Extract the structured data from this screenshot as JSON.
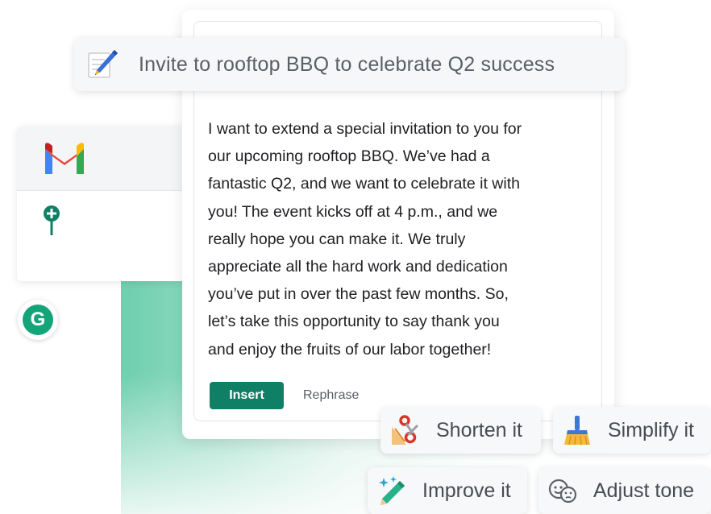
{
  "prompt": {
    "text": "Invite to rooftop BBQ to celebrate Q2 success",
    "icon": "pen-icon"
  },
  "message": {
    "lines": [
      "I want to extend a special invitation to you for",
      "our upcoming rooftop BBQ. We’ve had a",
      "fantastic Q2, and we want to celebrate it with",
      "you! The event kicks off at 4 p.m., and we",
      "really hope you can make it. We truly",
      "appreciate all the hard work and dedication",
      "you’ve put in over the past few months. So,",
      "let’s take this opportunity to say thank you",
      "and enjoy the fruits of our labor together!"
    ]
  },
  "actions": {
    "insert_label": "Insert",
    "rephrase_label": "Rephrase"
  },
  "chips": {
    "shorten": "Shorten it",
    "simplify": "Simplify it",
    "improve": "Improve it",
    "tone": "Adjust tone"
  },
  "badge": {
    "letter": "G"
  },
  "colors": {
    "accent": "#0f7f66",
    "grammarly_green": "#15a37a",
    "gmail_red": "#ea4335"
  }
}
